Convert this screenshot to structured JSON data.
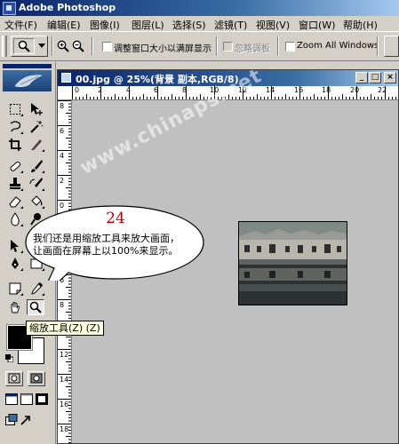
{
  "app": {
    "title": "Adobe Photoshop"
  },
  "menu": {
    "items": [
      {
        "label": "文件(F)"
      },
      {
        "label": "编辑(E)"
      },
      {
        "label": "图像(I)"
      },
      {
        "label": "图层(L)"
      },
      {
        "label": "选择(S)"
      },
      {
        "label": "滤镜(T)"
      },
      {
        "label": "视图(V)"
      },
      {
        "label": "窗口(W)"
      },
      {
        "label": "帮助(H)"
      }
    ]
  },
  "options": {
    "resize_windows_label": "调整窗口大小以满屏显示",
    "ignore_palettes_label": "忽略调板",
    "zoom_all_windows_label": "Zoom All Windows"
  },
  "document": {
    "title": "00.jpg @ 25%(背景 副本,RGB/8)",
    "ruler_top_numbers": [
      "0",
      "2",
      "4",
      "6",
      "8",
      "10",
      "12",
      "14",
      "16",
      "18",
      "20",
      "22"
    ],
    "ruler_left_numbers": [
      "8",
      "6",
      "4",
      "2",
      "0",
      "2",
      "4",
      "6",
      "8",
      "10",
      "12",
      "14",
      "16",
      "18"
    ]
  },
  "callout": {
    "step_number": "24",
    "text_line1": "我们还是用缩放工具来放大画面，",
    "text_line2": "让画面在屏幕上以100%来显示。"
  },
  "tooltip": {
    "text": "缩放工具(Z) (Z)"
  },
  "watermark": {
    "text": "www.chinaps.net"
  },
  "colors": {
    "title_bar": "#0a246a",
    "callout_number": "#c00000",
    "tooltip_bg": "#ffffe1",
    "canvas_bg": "#c0c0c0"
  }
}
